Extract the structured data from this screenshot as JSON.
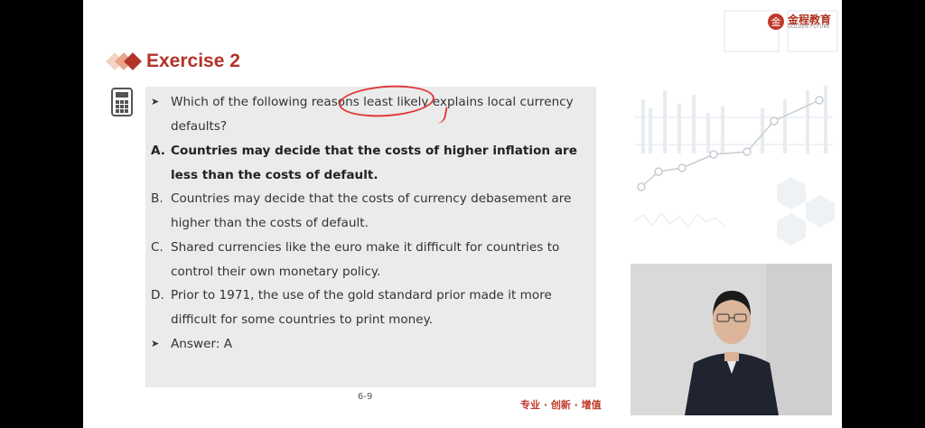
{
  "logo": {
    "cn": "金程教育",
    "en": "GOLDEN FUTURE"
  },
  "title": "Exercise 2",
  "question": {
    "stem": "Which of the following reasons least likely explains local currency defaults?",
    "options": [
      {
        "letter": "A.",
        "text": "Countries may decide that the costs of higher inflation are less than the costs of default.",
        "correct": true
      },
      {
        "letter": "B.",
        "text": "Countries may decide that the costs of currency debasement are higher than the costs of default.",
        "correct": false
      },
      {
        "letter": "C.",
        "text": "Shared currencies like the euro make it difficult for countries to control their own monetary policy.",
        "correct": false
      },
      {
        "letter": "D.",
        "text": "Prior to 1971, the use of the gold standard prior made it more difficult for some countries to print money.",
        "correct": false
      }
    ],
    "answer": "Answer: A"
  },
  "footer": {
    "page": "6-9",
    "slogan": "专业 · 创新 · 增值"
  },
  "colors": {
    "title": "#b3322a",
    "annotation": "#e03a3a",
    "box": "#ebebeb",
    "accent": "#c0392b"
  },
  "icons": {
    "bullet": "arrow-bullet-icon",
    "calculator": "calculator-icon"
  }
}
